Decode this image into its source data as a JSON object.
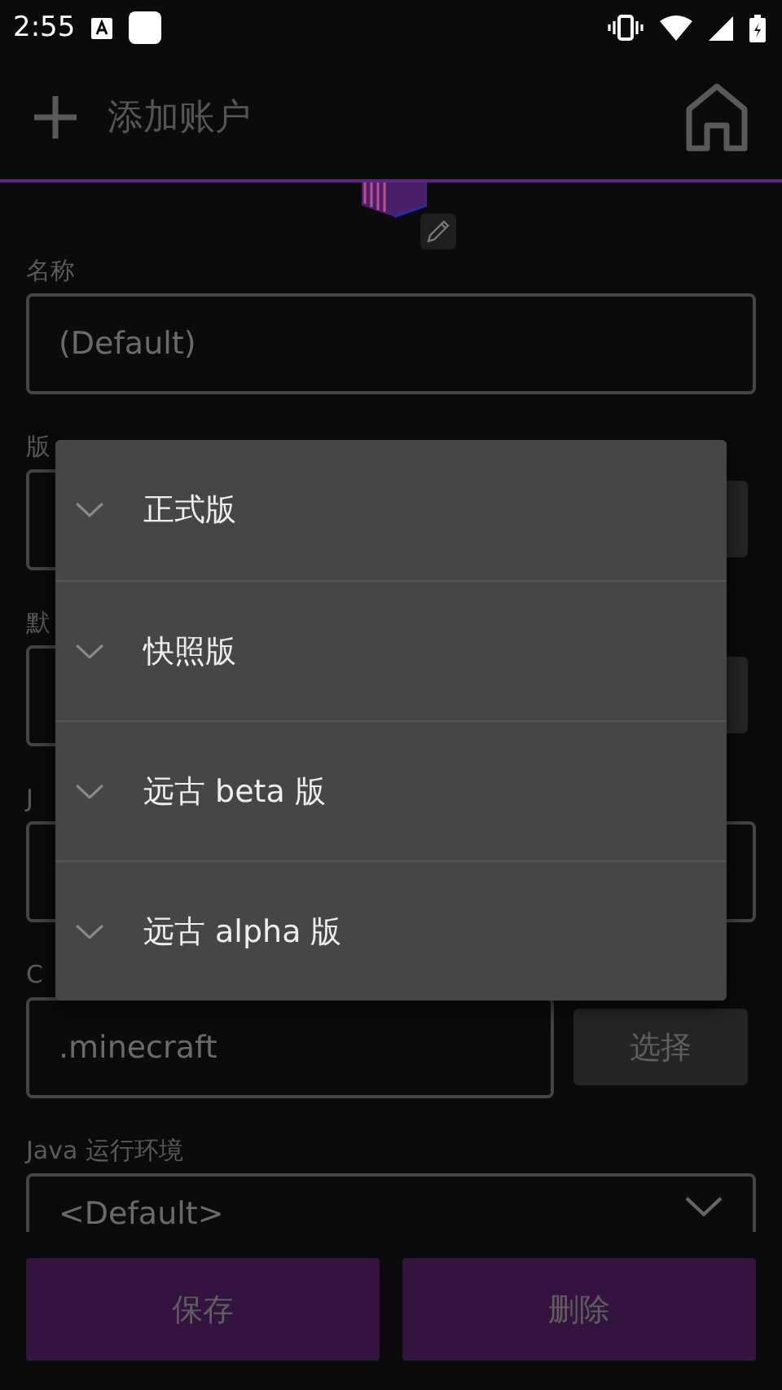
{
  "status_bar": {
    "time": "2:55"
  },
  "app_bar": {
    "title": "添加账户"
  },
  "form": {
    "fields": [
      {
        "label": "名称",
        "value": "(Default)",
        "kind": "text"
      },
      {
        "label": "版",
        "kind": "picker"
      },
      {
        "label": "默",
        "kind": "picker"
      },
      {
        "label": "J",
        "kind": "text"
      },
      {
        "label": "C",
        "value": ".minecraft",
        "kind": "path",
        "button": "选择"
      },
      {
        "label": "Java 运行环境",
        "value": "<Default>",
        "kind": "dropdown"
      }
    ]
  },
  "menu": {
    "items": [
      {
        "label": "正式版"
      },
      {
        "label": "快照版"
      },
      {
        "label": "远古 beta 版"
      },
      {
        "label": "远古 alpha 版"
      }
    ]
  },
  "buttons": [
    {
      "label": "保存"
    },
    {
      "label": "删除"
    }
  ]
}
